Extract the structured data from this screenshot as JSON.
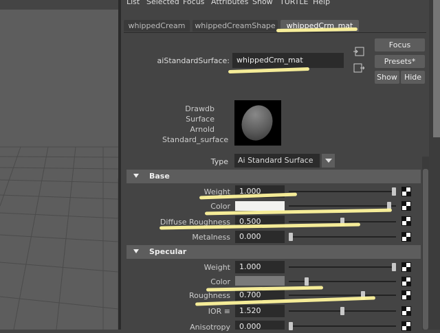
{
  "menubar": [
    "List",
    "Selected",
    "Focus",
    "Attributes",
    "Show",
    "TURTLE",
    "Help"
  ],
  "tabs": [
    {
      "label": "whippedCream",
      "active": false
    },
    {
      "label": "whippedCreamShape",
      "active": false
    },
    {
      "label": "whippedCrm_mat",
      "active": true
    }
  ],
  "material": {
    "type_label": "aiStandardSurface:",
    "name": "whippedCrm_mat"
  },
  "buttons": {
    "focus": "Focus",
    "presets": "Presets*",
    "show": "Show",
    "hide": "Hide"
  },
  "classification": [
    "Drawdb",
    "Surface",
    "Arnold",
    "Standard_surface"
  ],
  "type": {
    "label": "Type",
    "value": "Ai Standard Surface"
  },
  "sections": {
    "base": {
      "title": "Base",
      "weight": {
        "label": "Weight",
        "value": "1.000",
        "slider": 1.0
      },
      "color": {
        "label": "Color",
        "swatch": "#f2f2f0",
        "slider": 0.95
      },
      "diffuse_roughness": {
        "label": "Diffuse Roughness",
        "value": "0.500",
        "slider": 0.5
      },
      "metalness": {
        "label": "Metalness",
        "value": "0.000",
        "slider": 0.0
      }
    },
    "specular": {
      "title": "Specular",
      "weight": {
        "label": "Weight",
        "value": "1.000",
        "slider": 1.0
      },
      "color": {
        "label": "Color",
        "swatch": "#7a7a7a",
        "slider": 0.15
      },
      "roughness": {
        "label": "Roughness",
        "value": "0.700",
        "slider": 0.7
      },
      "ior": {
        "label": "IOR ≡",
        "value": "1.520",
        "slider": 0.5
      },
      "anisotropy": {
        "label": "Anisotropy",
        "value": "0.000",
        "slider": 0.0
      }
    }
  },
  "colors": {
    "highlight": "#fff59d",
    "panel": "#444444",
    "header": "#5d5d5d"
  }
}
